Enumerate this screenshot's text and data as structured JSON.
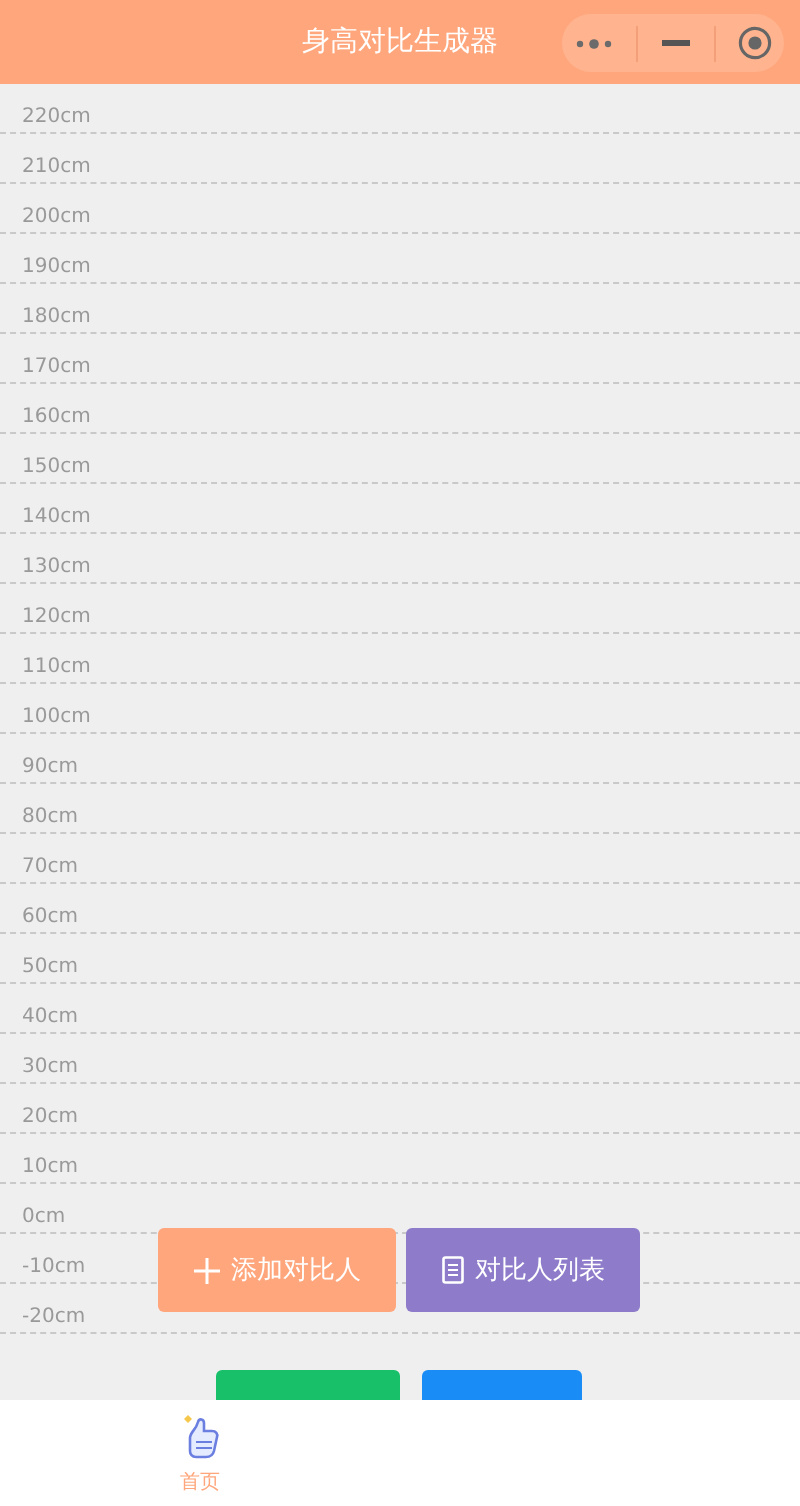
{
  "header": {
    "title": "身高对比生成器"
  },
  "ruler": {
    "marks": [
      "220cm",
      "210cm",
      "200cm",
      "190cm",
      "180cm",
      "170cm",
      "160cm",
      "150cm",
      "140cm",
      "130cm",
      "120cm",
      "110cm",
      "100cm",
      "90cm",
      "80cm",
      "70cm",
      "60cm",
      "50cm",
      "40cm",
      "30cm",
      "20cm",
      "10cm",
      "0cm",
      "-10cm",
      "-20cm"
    ]
  },
  "actions": [
    {
      "kind": "add",
      "label": "添加对比人"
    },
    {
      "kind": "list",
      "label": "对比人列表"
    }
  ],
  "share_actions": [
    {
      "kind": "share"
    },
    {
      "kind": "download"
    }
  ],
  "tab_bar": [
    {
      "label": "首页",
      "selected": true
    }
  ]
}
